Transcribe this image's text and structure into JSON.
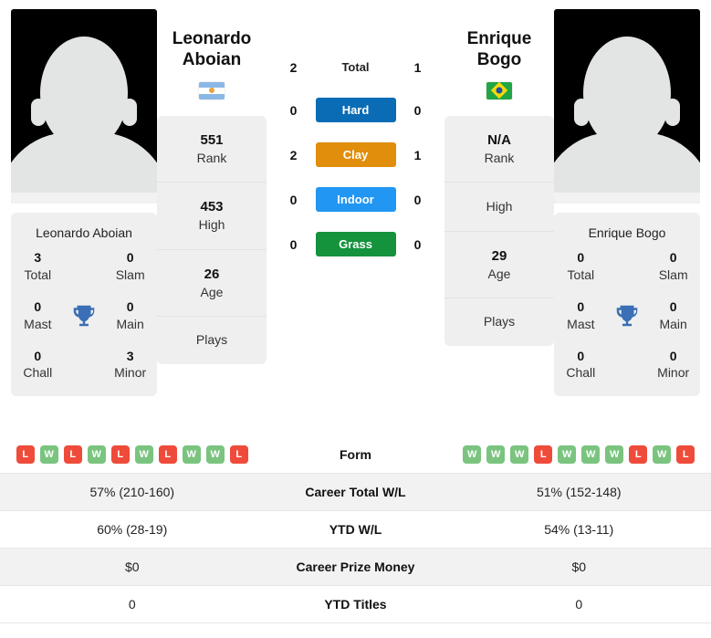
{
  "players": {
    "left": {
      "first_name": "Leonardo",
      "last_name": "Aboian",
      "full_name": "Leonardo Aboian",
      "flag": "argentina-flag",
      "rank": "551",
      "rank_label": "Rank",
      "high": "453",
      "high_label": "High",
      "age": "26",
      "age_label": "Age",
      "plays_label": "Plays",
      "plays_value": "",
      "titles": {
        "total": "3",
        "total_label": "Total",
        "slam": "0",
        "slam_label": "Slam",
        "mast": "0",
        "mast_label": "Mast",
        "main": "0",
        "main_label": "Main",
        "chall": "0",
        "chall_label": "Chall",
        "minor": "3",
        "minor_label": "Minor"
      },
      "form": [
        "L",
        "W",
        "L",
        "W",
        "L",
        "W",
        "L",
        "W",
        "W",
        "L"
      ],
      "career_total_wl": "57% (210-160)",
      "ytd_wl": "60% (28-19)",
      "career_prize_money": "$0",
      "ytd_titles": "0"
    },
    "right": {
      "first_name": "Enrique",
      "last_name": "Bogo",
      "full_name": "Enrique Bogo",
      "flag": "brazil-flag",
      "rank": "N/A",
      "rank_label": "Rank",
      "high": "",
      "high_label": "High",
      "age": "29",
      "age_label": "Age",
      "plays_label": "Plays",
      "plays_value": "",
      "titles": {
        "total": "0",
        "total_label": "Total",
        "slam": "0",
        "slam_label": "Slam",
        "mast": "0",
        "mast_label": "Mast",
        "main": "0",
        "main_label": "Main",
        "chall": "0",
        "chall_label": "Chall",
        "minor": "0",
        "minor_label": "Minor"
      },
      "form": [
        "W",
        "W",
        "W",
        "L",
        "W",
        "W",
        "W",
        "L",
        "W",
        "L"
      ],
      "career_total_wl": "51% (152-148)",
      "ytd_wl": "54% (13-11)",
      "career_prize_money": "$0",
      "ytd_titles": "0"
    }
  },
  "head_to_head": [
    {
      "label": "Total",
      "left": "2",
      "right": "1",
      "style": "plain",
      "color": ""
    },
    {
      "label": "Hard",
      "left": "0",
      "right": "0",
      "style": "badge",
      "color": "#0a6cb5"
    },
    {
      "label": "Clay",
      "left": "2",
      "right": "1",
      "style": "badge",
      "color": "#e08e0b"
    },
    {
      "label": "Indoor",
      "left": "0",
      "right": "0",
      "style": "badge",
      "color": "#2196f3"
    },
    {
      "label": "Grass",
      "left": "0",
      "right": "0",
      "style": "badge",
      "color": "#14923c"
    }
  ],
  "stats_table": {
    "rows": [
      {
        "label": "Form",
        "type": "form"
      },
      {
        "label": "Career Total W/L",
        "type": "text",
        "left": "57% (210-160)",
        "right": "51% (152-148)"
      },
      {
        "label": "YTD W/L",
        "type": "text",
        "left": "60% (28-19)",
        "right": "54% (13-11)"
      },
      {
        "label": "Career Prize Money",
        "type": "text",
        "left": "$0",
        "right": "$0"
      },
      {
        "label": "YTD Titles",
        "type": "text",
        "left": "0",
        "right": "0"
      }
    ]
  },
  "colors": {
    "win": "#7ac47f",
    "loss": "#ef4b3a",
    "trophy": "#3b6fb6",
    "card_bg": "#efefef"
  }
}
